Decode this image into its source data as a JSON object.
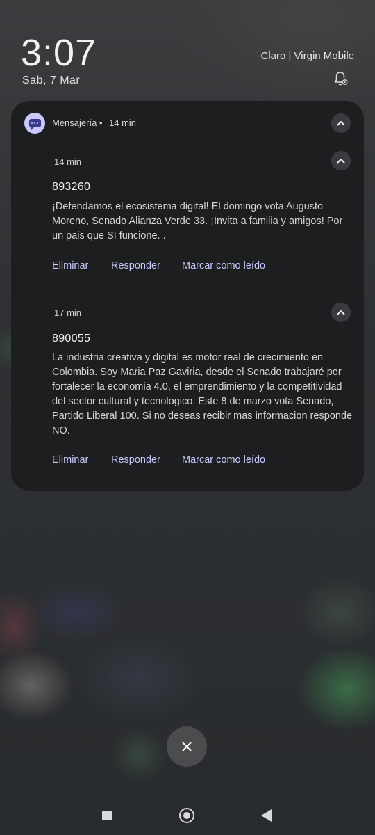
{
  "lockscreen": {
    "time": "3:07",
    "date": "Sab, 7 Mar",
    "carrier": "Claro | Virgin Mobile"
  },
  "notification": {
    "app_name": "Mensajería",
    "separator": "•",
    "app_time": "14 min",
    "messages": [
      {
        "time": "14 min",
        "sender": "893260",
        "body": "¡Defendamos el ecosistema digital! El domingo vota Augusto Moreno, Senado Alianza Verde 33. ¡Invita a familia y amigos! Por un pais que SI funcione. ."
      },
      {
        "time": "17 min",
        "sender": "890055",
        "body": "La industria creativa y digital es motor real de crecimiento en Colombia. Soy Maria Paz Gaviria, desde el Senado trabajaré por fortalecer la economia 4.0, el emprendimiento y la competitividad del sector cultural y tecnologico. Este 8 de marzo vota Senado, Partido Liberal 100. Si no deseas recibir mas informacion responde NO."
      }
    ],
    "actions": {
      "delete": "Eliminar",
      "reply": "Responder",
      "mark_read": "Marcar como leído"
    }
  },
  "icons": {
    "app": "messaging-icon",
    "bell": "notification-settings-icon",
    "collapse": "chevron-up-icon",
    "close": "close-icon"
  },
  "colors": {
    "panel": "#1d1e20",
    "action_text": "#c6cbff",
    "app_icon_bg": "#c9c8ff"
  }
}
